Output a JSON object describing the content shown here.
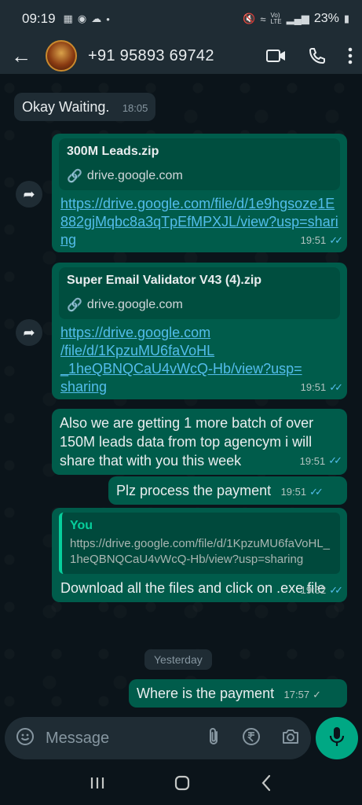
{
  "status": {
    "time": "09:19",
    "battery": "23%",
    "volte": "Vo))\nLTE"
  },
  "header": {
    "contact": "+91 95893 69742"
  },
  "messages": [
    {
      "dir": "in",
      "text": "Okay Waiting.",
      "time": "18:05"
    },
    {
      "dir": "out",
      "preview_title": "300M Leads.zip",
      "preview_domain": "drive.google.com",
      "link": "https://drive.google.com/file/d/1e9hgsoze1E882gjMqbc8a3qTpEfMPXJL/view?usp=sharing",
      "time": "19:51"
    },
    {
      "dir": "out",
      "preview_title": "Super Email Validator V43 (4).zip",
      "preview_domain": "drive.google.com",
      "link_lines": [
        "https://drive.google.com",
        "/file/d/1KpzuMU6faVoHL",
        "_1heQBNQCaU4vWcQ-Hb/view?usp=",
        "sharing"
      ],
      "time": "19:51"
    },
    {
      "dir": "out",
      "text": "Also we are getting 1 more batch of over 150M leads data from top agencym i will share that with you this week",
      "time": "19:51"
    },
    {
      "dir": "out",
      "text": "Plz process the payment",
      "time": "19:51"
    },
    {
      "dir": "out",
      "quote_name": "You",
      "quote_text": "https://drive.google.com/file/d/1KpzuMU6faVoHL_1heQBNQCaU4vWcQ-Hb/view?usp=sharing",
      "text": "Download all the files and click on .exe file",
      "time": "19:52"
    },
    {
      "dir": "out",
      "text": "Where is the payment",
      "time": "17:57"
    }
  ],
  "date_separator": "Yesterday",
  "composer": {
    "placeholder": "Message"
  },
  "colors": {
    "incoming": "#1f2c34",
    "outgoing": "#005c4b",
    "accent": "#00a884",
    "link": "#53bdeb",
    "read_tick": "#53bdeb"
  }
}
